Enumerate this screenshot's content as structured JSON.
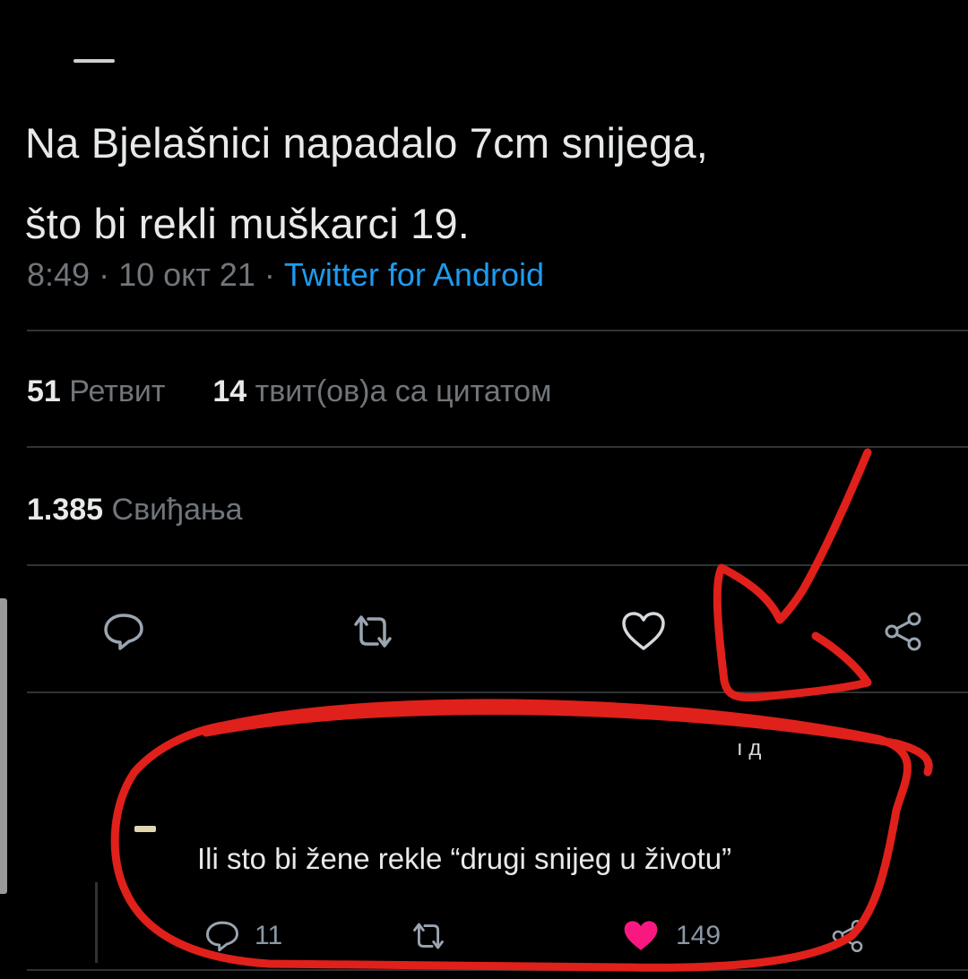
{
  "tweet": {
    "text_line1": "Na Bjelašnici napadalo 7cm snijega,",
    "text_line2": "što bi rekli muškarci 19.",
    "time": "8:49",
    "date": "10 окт 21",
    "source": "Twitter for Android"
  },
  "stats": {
    "retweets_count": "51",
    "retweets_label": "Ретвит",
    "quotes_count": "14",
    "quotes_label": "твит(ов)а са цитатом",
    "likes_count": "1.385",
    "likes_label": "Свиђања"
  },
  "actions": {
    "icons": [
      "reply-icon",
      "retweet-icon",
      "like-icon",
      "share-icon"
    ]
  },
  "reply": {
    "artifact_text": "ı д",
    "text": "Ili sto bi žene rekle “drugi snijeg u životu”",
    "reply_count": "11",
    "like_count": "149",
    "like_color": "#f91880"
  },
  "annotation": {
    "color": "#e0201b"
  }
}
